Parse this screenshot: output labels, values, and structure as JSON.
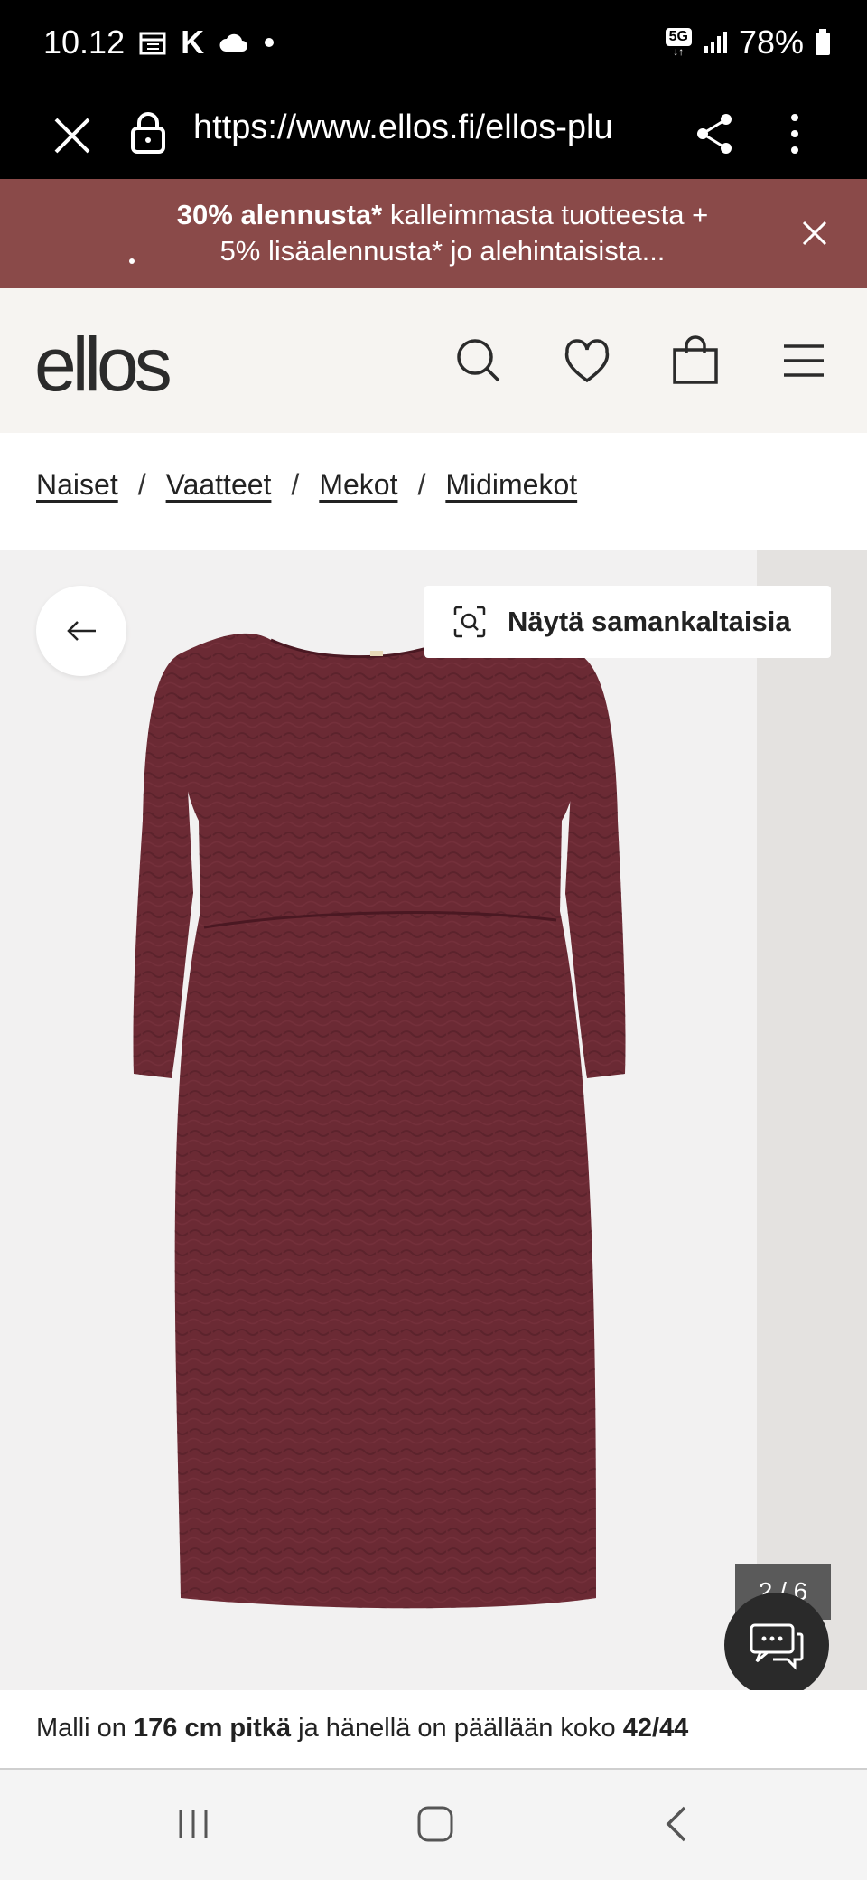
{
  "status_bar": {
    "time": "10.12",
    "carrier_letter": "K",
    "network": "5G",
    "battery": "78%"
  },
  "browser": {
    "url": "https://www.ellos.fi/ellos-plu"
  },
  "promo": {
    "bold": "30% alennusta*",
    "text1": " kalleimmasta tuotteesta +",
    "text2": "5% lisäalennusta* jo alehintaisista..."
  },
  "header": {
    "logo": "ellos"
  },
  "breadcrumb": {
    "items": [
      "Naiset",
      "Vaatteet",
      "Mekot",
      "Midimekot"
    ],
    "separator": "/"
  },
  "gallery": {
    "similar_label": "Näytä samankaltaisia",
    "counter": "2 / 6",
    "dress_color": "#6b2a34"
  },
  "model_info": {
    "prefix": "Malli on ",
    "height": "176 cm pitkä",
    "middle": " ja hänellä on päällään koko ",
    "size": "42/44"
  },
  "colors": {
    "promo_bg": "#8a4a49",
    "header_bg": "#f6f4f1"
  }
}
